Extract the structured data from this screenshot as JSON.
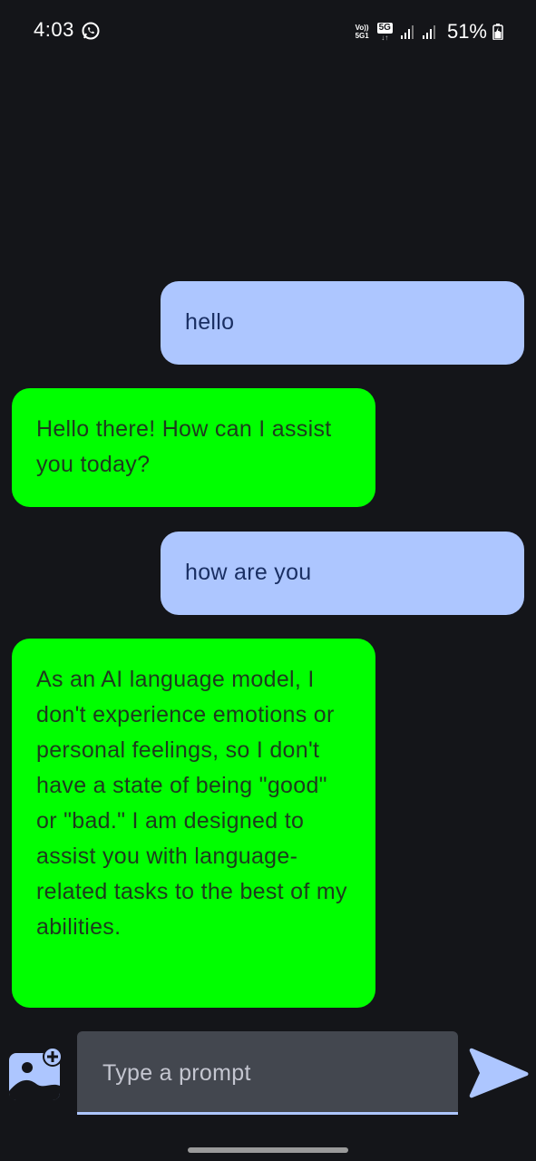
{
  "status_bar": {
    "time": "4:03",
    "volte_line1": "Vo))",
    "volte_line2": "5G1",
    "network": "5G",
    "network_arrows": "↓↑",
    "battery": "51%",
    "app_icon": "whatsapp-icon",
    "signal_icon": "signal-icon",
    "battery_icon": "battery-icon"
  },
  "messages": [
    {
      "role": "user",
      "text": "hello"
    },
    {
      "role": "assistant",
      "text": "Hello there! How can I assist you today?"
    },
    {
      "role": "user",
      "text": "how are you"
    },
    {
      "role": "assistant",
      "text": "As an AI language model, I don't experience emotions or personal feelings, so I don't have a state of being \"good\" or \"bad.\" I am designed to assist you with language-related tasks to the best of my abilities."
    }
  ],
  "input": {
    "placeholder": "Type a prompt",
    "value": ""
  },
  "icons": {
    "image_add": "add-photo-icon",
    "send": "send-icon"
  },
  "colors": {
    "background": "#141519",
    "user_bubble": "#adc6ff",
    "user_text": "#1a2f63",
    "assistant_bubble": "#00ff00",
    "assistant_text": "#1e3a1e",
    "input_background": "#43474f",
    "accent": "#adc6ff"
  }
}
